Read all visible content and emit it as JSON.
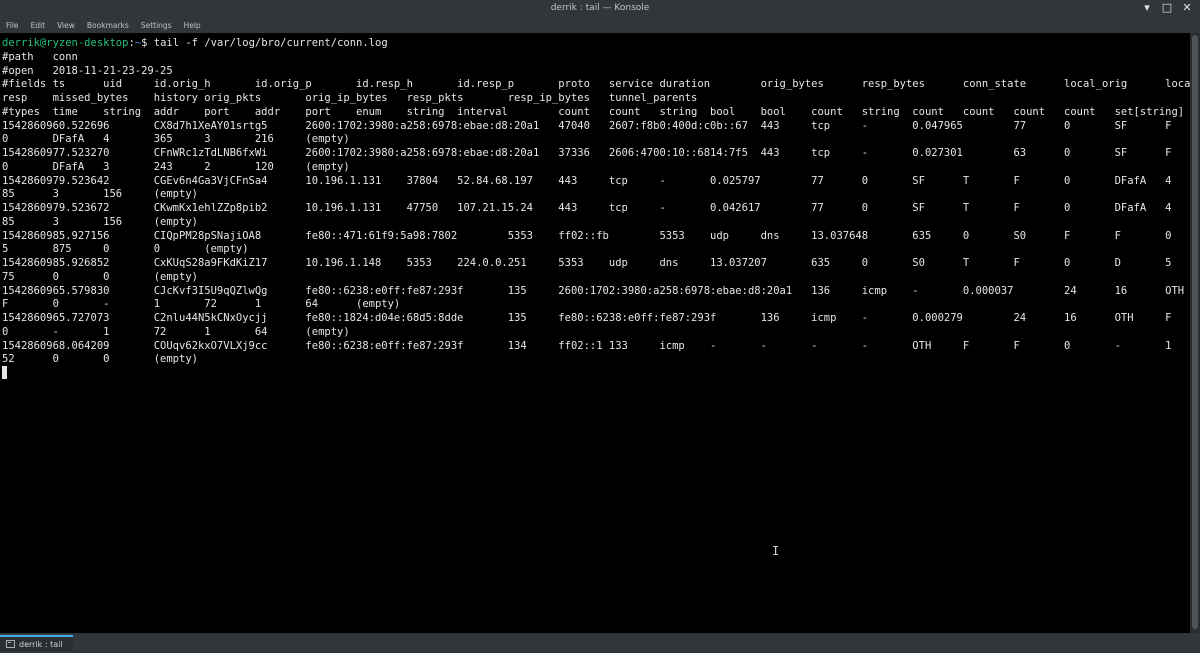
{
  "window": {
    "title": "derrik : tail — Konsole",
    "controls": {
      "minimize": "▾",
      "maximize": "□",
      "close": "✕"
    }
  },
  "menubar": {
    "items": [
      "File",
      "Edit",
      "View",
      "Bookmarks",
      "Settings",
      "Help"
    ]
  },
  "terminal": {
    "prompt_user": "derrik@ryzen-desktop",
    "prompt_sep": ":",
    "prompt_path": "~",
    "prompt_dollar": "$ ",
    "command": "tail -f /var/log/bro/current/conn.log",
    "lines": [
      "#path   conn",
      "#open   2018-11-21-23-29-25",
      "#fields ts      uid     id.orig_h       id.orig_p       id.resp_h       id.resp_p       proto   service duration        orig_bytes      resp_bytes      conn_state      local_orig      local_",
      "resp    missed_bytes    history orig_pkts       orig_ip_bytes   resp_pkts       resp_ip_bytes   tunnel_parents",
      "#types  time    string  addr    port    addr    port    enum    string  interval        count   count   string  bool    bool    count   string  count   count   count   count   set[string]",
      "1542860960.522696       CX8d7h1XeAY01srtg5      2600:1702:3980:a258:6978:ebae:d8:20a1   47040   2607:f8b0:400d:c0b::67  443     tcp     -       0.047965        77      0       SF      F       F",
      "0       DFafA   4       365     3       216     (empty)",
      "1542860977.523270       CFnWRc1zTdLNB6fxWi      2600:1702:3980:a258:6978:ebae:d8:20a1   37336   2606:4700:10::6814:7f5  443     tcp     -       0.027301        63      0       SF      F       F",
      "0       DFafA   3       243     2       120     (empty)",
      "1542860979.523642       CGEv6n4Ga3VjCFnSa4      10.196.1.131    37804   52.84.68.197    443     tcp     -       0.025797        77      0       SF      T       F       0       DFafA   4       2",
      "85      3       156     (empty)",
      "1542860979.523672       CKwmKx1ehlZZp8pib2      10.196.1.131    47750   107.21.15.24    443     tcp     -       0.042617        77      0       SF      T       F       0       DFafA   4       2",
      "85      3       156     (empty)",
      "1542860985.927156       CIQpPM28pSNajiOA8       fe80::471:61f9:5a98:7802        5353    ff02::fb        5353    udp     dns     13.037648       635     0       S0      F       F       0       D",
      "5       875     0       0       (empty)",
      "1542860985.926852       CxKUqS28a9FKdKiZ17      10.196.1.148    5353    224.0.0.251     5353    udp     dns     13.037207       635     0       S0      T       F       0       D       5       7",
      "75      0       0       (empty)",
      "1542860965.579830       CJcKvf3I5U9qQZlwQg      fe80::6238:e0ff:fe87:293f       135     2600:1702:3980:a258:6978:ebae:d8:20a1   136     icmp    -       0.000037        24      16      OTH     F",
      "F       0       -       1       72      1       64      (empty)",
      "1542860965.727073       C2nlu44N5kCNxOycjj      fe80::1824:d04e:68d5:8dde       135     fe80::6238:e0ff:fe87:293f       136     icmp    -       0.000279        24      16      OTH     F       F",
      "0       -       1       72      1       64      (empty)",
      "1542860968.064209       COUqv62kxO7VLXj9cc      fe80::6238:e0ff:fe87:293f       134     ff02::1 133     icmp    -       -       -       -       OTH     F       F       0       -       1       1",
      "52      0       0       (empty)"
    ]
  },
  "tab": {
    "label": "derrik : tail"
  }
}
